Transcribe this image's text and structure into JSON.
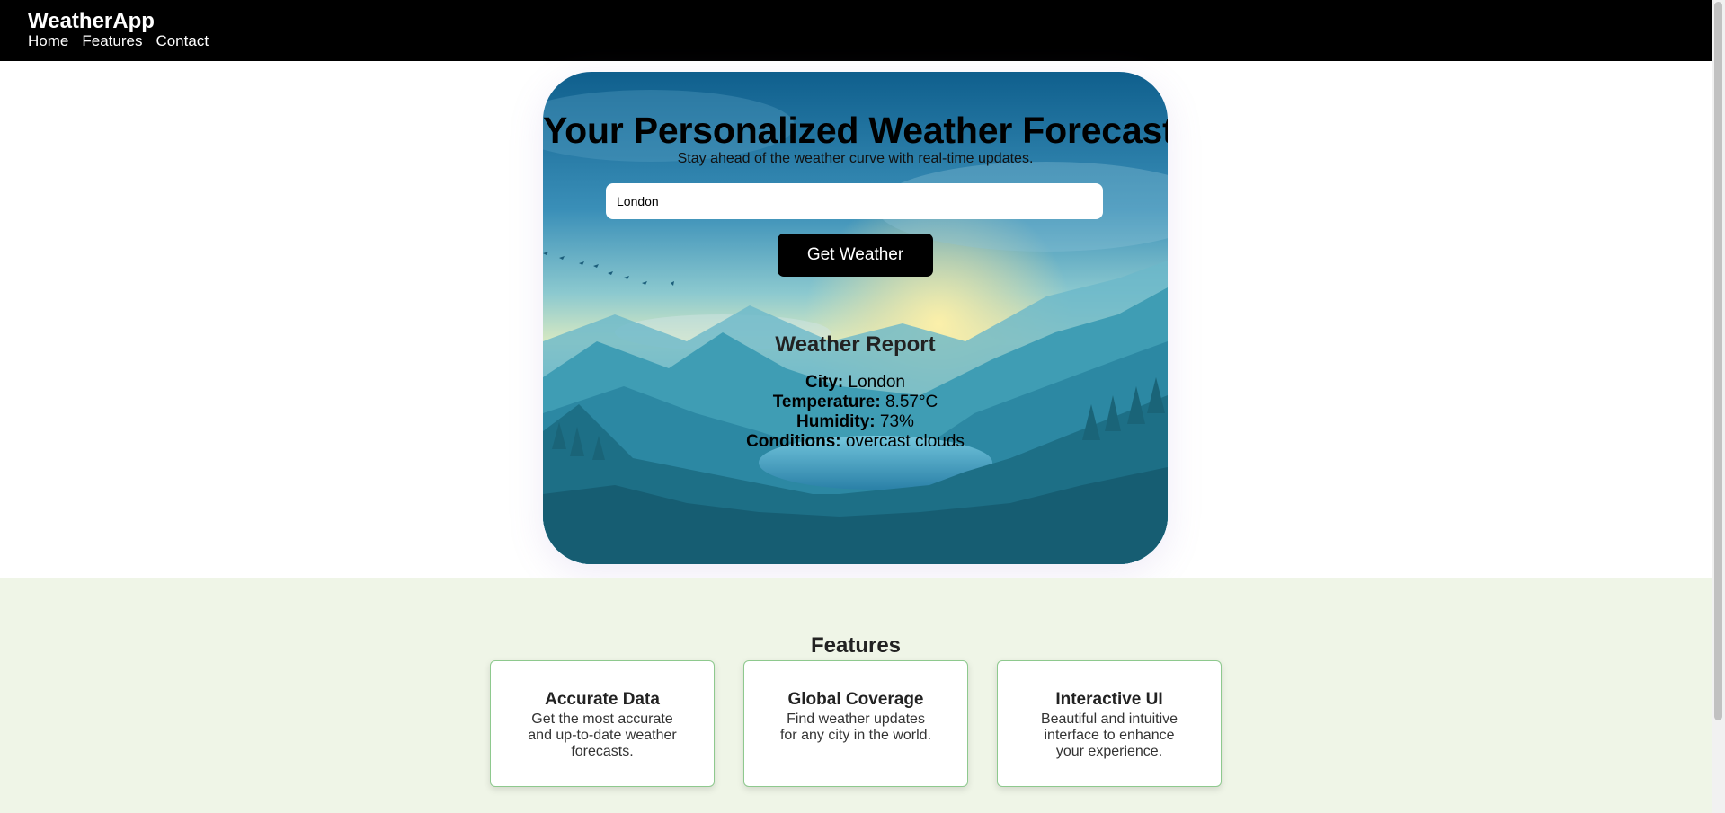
{
  "nav": {
    "brand": "WeatherApp",
    "links": [
      "Home",
      "Features",
      "Contact"
    ]
  },
  "hero": {
    "title": "Your Personalized Weather Forecast",
    "subtitle": "Stay ahead of the weather curve with real-time updates.",
    "city_input_value": "London",
    "button_label": "Get Weather"
  },
  "report": {
    "title": "Weather Report",
    "city_label": "City:",
    "city": "London",
    "temperature_label": "Temperature:",
    "temperature": "8.57°C",
    "humidity_label": "Humidity:",
    "humidity": "73%",
    "conditions_label": "Conditions:",
    "conditions": "overcast clouds"
  },
  "features": {
    "title": "Features",
    "cards": [
      {
        "title": "Accurate Data",
        "text": "Get the most accurate and up-to-date weather forecasts."
      },
      {
        "title": "Global Coverage",
        "text": "Find weather updates for any city in the world."
      },
      {
        "title": "Interactive UI",
        "text": "Beautiful and intuitive interface to enhance your experience."
      }
    ]
  },
  "colors": {
    "navbar": "#000000",
    "features_bg": "#eff5e7",
    "card_border": "#8ec98e",
    "button": "#000000"
  }
}
